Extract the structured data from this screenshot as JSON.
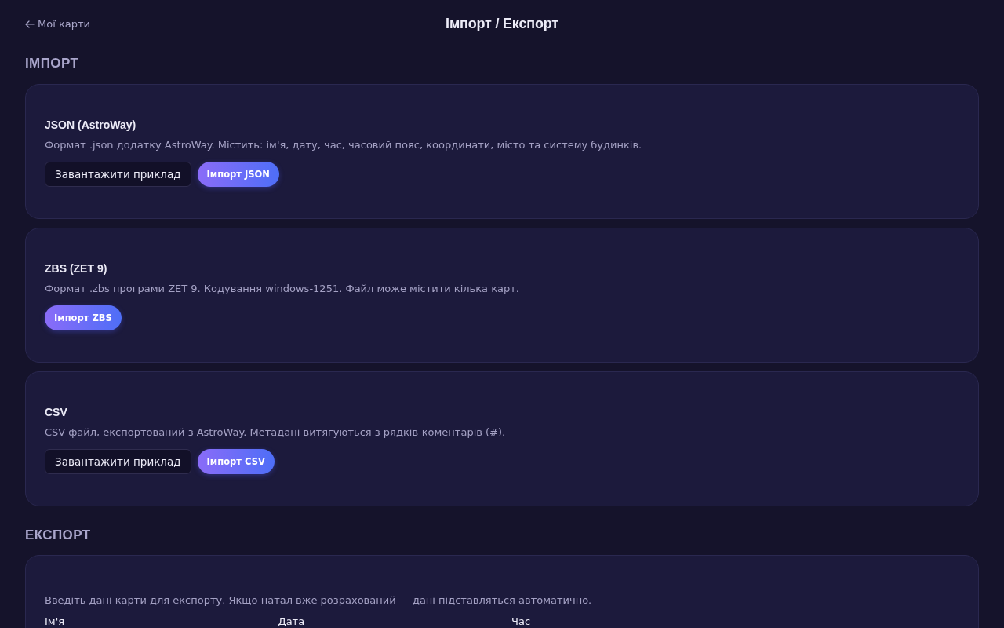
{
  "header": {
    "back_link": "Мої карти",
    "title": "Імпорт / Експорт"
  },
  "import": {
    "heading": "ІМПОРТ",
    "formats": [
      {
        "title": "JSON (AstroWay)",
        "description": "Формат .json додатку AstroWay. Містить: ім'я, дату, час, часовий пояс, координати, місто та систему будинків.",
        "buttons": [
          {
            "label": "Завантажити приклад",
            "kind": "secondary"
          },
          {
            "label": "Імпорт JSON",
            "kind": "primary"
          }
        ]
      },
      {
        "title": "ZBS (ZET 9)",
        "description": "Формат .zbs програми ZET 9. Кодування windows-1251. Файл може містити кілька карт.",
        "buttons": [
          {
            "label": "Імпорт ZBS",
            "kind": "primary"
          }
        ]
      },
      {
        "title": "CSV",
        "description": "CSV-файл, експортований з AstroWay. Метадані витягуються з рядків-коментарів (#).",
        "buttons": [
          {
            "label": "Завантажити приклад",
            "kind": "secondary"
          },
          {
            "label": "Імпорт CSV",
            "kind": "primary"
          }
        ]
      }
    ]
  },
  "export": {
    "heading": "ЕКСПОРТ",
    "description": "Введіть дані карти для експорту. Якщо натал вже розрахований — дані підставляться автоматично.",
    "field_labels": [
      "Ім'я",
      "Дата",
      "Час"
    ]
  }
}
